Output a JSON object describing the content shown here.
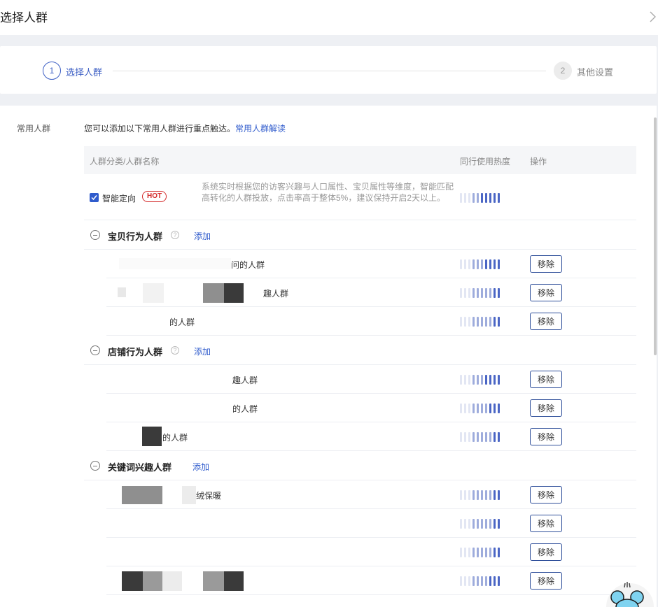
{
  "header": {
    "title": "选择人群"
  },
  "steps": [
    {
      "num": "1",
      "label": "选择人群"
    },
    {
      "num": "2",
      "label": "其他设置"
    }
  ],
  "section": {
    "label": "常用人群",
    "intro": "您可以添加以下常用人群进行重点触达。",
    "intro_link": "常用人群解读"
  },
  "table": {
    "col_name": "人群分类/人群名称",
    "col_heat": "同行使用热度",
    "col_op": "操作"
  },
  "smart": {
    "name": "智能定向",
    "badge": "HOT",
    "desc": "系统实时根据您的访客兴趣与人口属性、宝贝属性等维度，智能匹配高转化的人群投放，点击率高于整体5%，建议保持开启2天以上。",
    "heat": 5
  },
  "groups": [
    {
      "name": "宝贝行为人群",
      "add": "添加",
      "items": [
        {
          "name": "问的人群",
          "heat": 4,
          "remove": "移除"
        },
        {
          "name": "趣人群",
          "heat": 2,
          "remove": "移除"
        },
        {
          "name": "的人群",
          "heat": 2,
          "remove": "移除"
        }
      ]
    },
    {
      "name": "店铺行为人群",
      "add": "添加",
      "items": [
        {
          "name": "趣人群",
          "heat": 4,
          "remove": "移除"
        },
        {
          "name": "的人群",
          "heat": 3,
          "remove": "移除"
        },
        {
          "name": "的人群",
          "heat": 2,
          "remove": "移除"
        }
      ]
    },
    {
      "name": "关键词兴趣人群",
      "add": "添加",
      "items": [
        {
          "name": "绒保暖",
          "heat": 2,
          "remove": "移除"
        },
        {
          "name": "",
          "heat": 2,
          "remove": "移除"
        },
        {
          "name": "",
          "heat": 2,
          "remove": "移除"
        },
        {
          "name": "",
          "heat": 3,
          "remove": "移除"
        }
      ]
    }
  ],
  "colors": {
    "accent": "#2f5bcc",
    "hot": "#d42a2a",
    "heat_high": "#4b66c5",
    "heat_mid": "#9eacdc"
  }
}
